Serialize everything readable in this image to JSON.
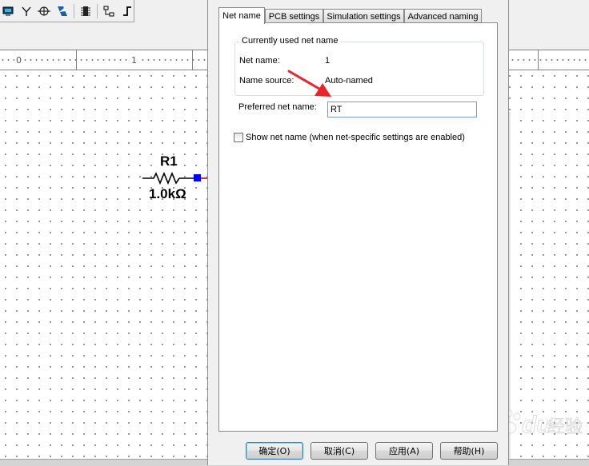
{
  "ruler": {
    "marks": [
      "0",
      "1"
    ]
  },
  "component": {
    "ref": "R1",
    "value": "1.0kΩ"
  },
  "dialog": {
    "tabs": [
      "Net name",
      "PCB settings",
      "Simulation settings",
      "Advanced naming"
    ],
    "active_tab": "Net name",
    "group_title": "Currently used net name",
    "net_name_label": "Net name:",
    "net_name_value": "1",
    "name_source_label": "Name source:",
    "name_source_value": "Auto-named",
    "preferred_label": "Preferred net name:",
    "preferred_value": "RT",
    "checkbox_label": "Show net name (when net-specific settings are enabled)",
    "checkbox_checked": false,
    "buttons": {
      "ok": "确定(O)",
      "cancel": "取消(C)",
      "apply": "应用(A)",
      "help": "帮助(H)"
    }
  },
  "colors": {
    "arrow": "#e8262a",
    "pin": "#0000ff",
    "wire": "#cc0000"
  },
  "watermark": "Baidu 经验"
}
